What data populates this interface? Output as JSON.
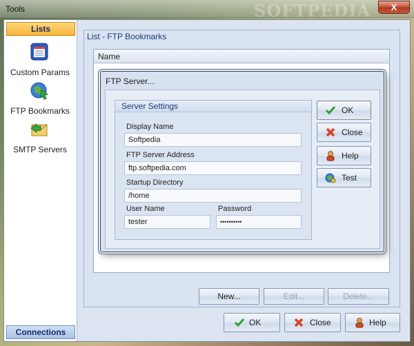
{
  "window": {
    "title": "Tools",
    "watermark": "SOFTPEDIA",
    "close_label": "X"
  },
  "sidebar": {
    "header": "Lists",
    "items": [
      {
        "label": "Custom Params",
        "icon": "custom-params-icon"
      },
      {
        "label": "FTP Bookmarks",
        "icon": "ftp-bookmarks-icon"
      },
      {
        "label": "SMTP Servers",
        "icon": "smtp-servers-icon"
      }
    ],
    "footer": "Connections"
  },
  "panel": {
    "title": "List - FTP Bookmarks",
    "column_header": "Name",
    "buttons": {
      "new": "New...",
      "edit": "Edit...",
      "delete": "Delete..."
    }
  },
  "dialog": {
    "title": "FTP Server...",
    "group_title": "Server Settings",
    "fields": {
      "display_name_label": "Display Name",
      "display_name_value": "Softpedia",
      "address_label": "FTP Server Address",
      "address_value": "ftp.softpedia.com",
      "startup_label": "Startup Directory",
      "startup_value": "/home",
      "user_label": "User Name",
      "user_value": "tester",
      "password_label": "Password",
      "password_value": "••••••••••"
    },
    "buttons": {
      "ok": "OK",
      "close": "Close",
      "help": "Help",
      "test": "Test"
    }
  },
  "footer_buttons": {
    "ok": "OK",
    "close": "Close",
    "help": "Help"
  },
  "colors": {
    "accent_orange": "#f7b437",
    "panel_blue": "#d9e3f1",
    "title_blue": "#1c3a78"
  }
}
